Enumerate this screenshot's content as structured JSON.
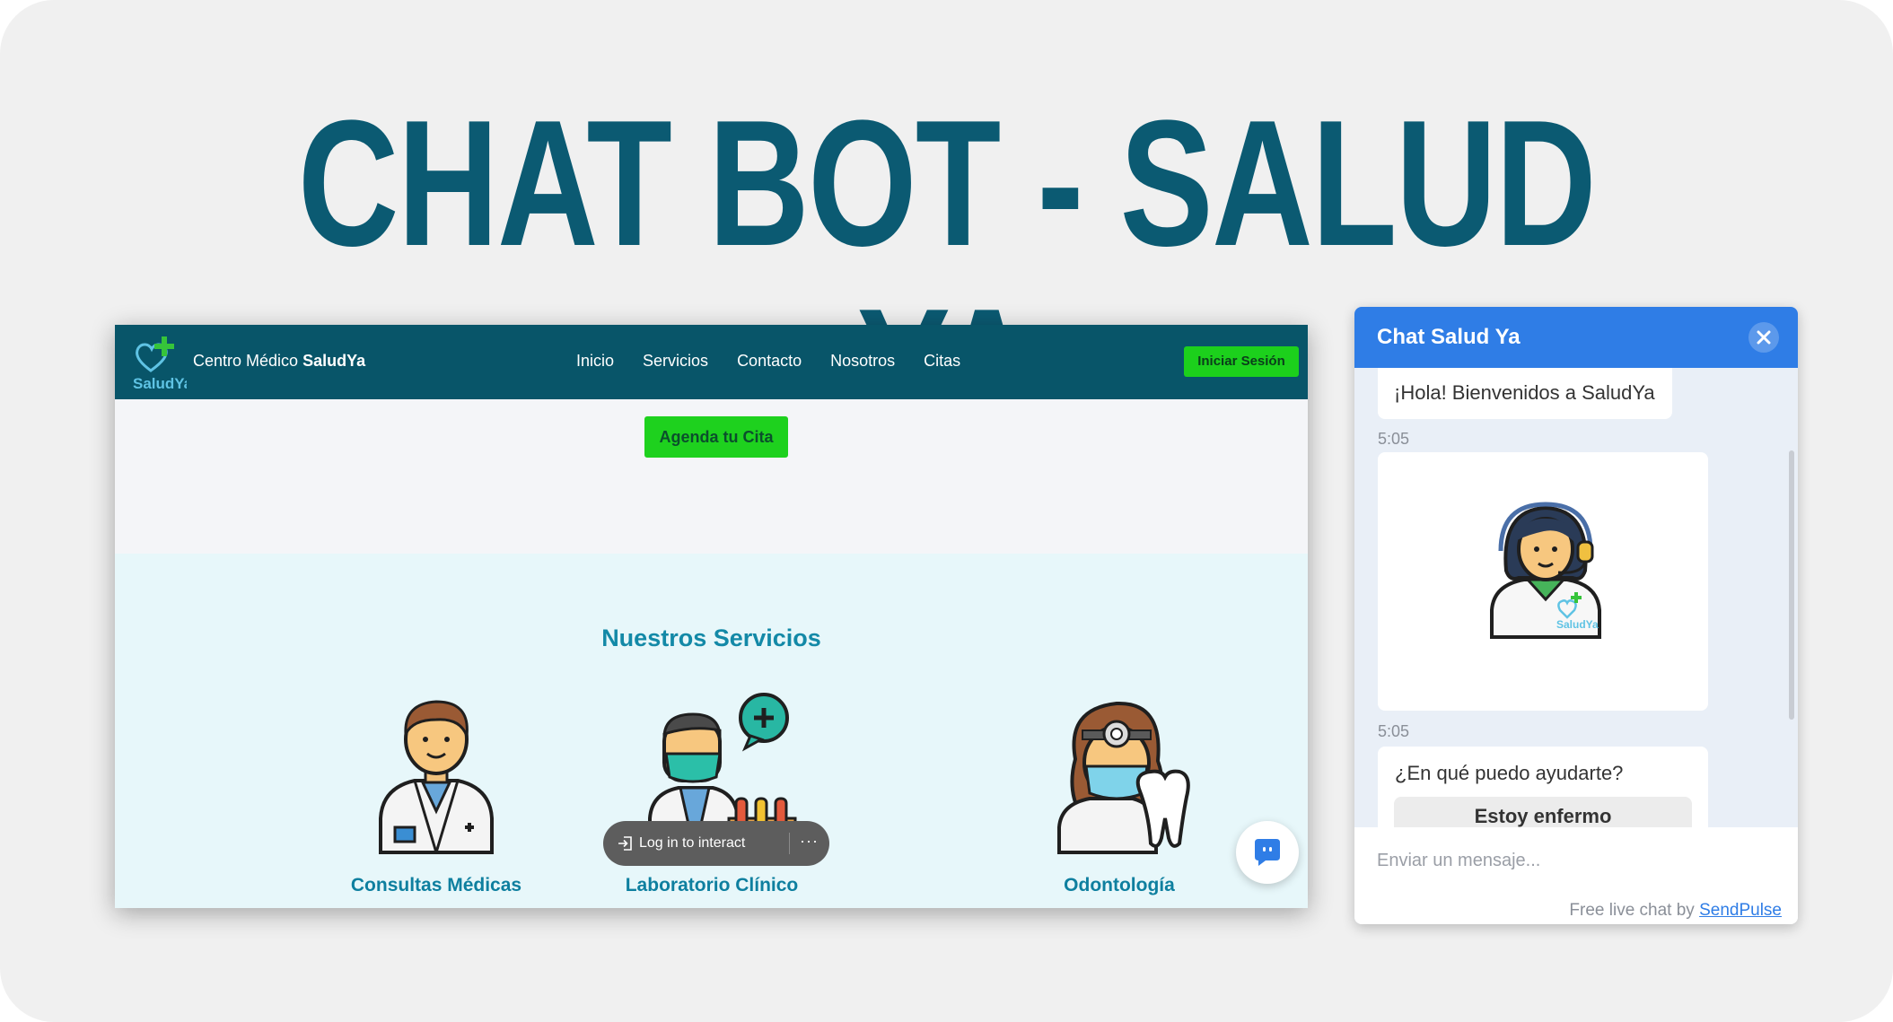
{
  "headline": "CHAT BOT - SALUD YA",
  "website": {
    "logo_text": "SaludYa",
    "brand_prefix": "Centro Médico",
    "brand_name": "SaludYa",
    "nav": [
      "Inicio",
      "Servicios",
      "Contacto",
      "Nosotros",
      "Citas"
    ],
    "login_button": "Iniciar Sesión",
    "cta_button": "Agenda tu Cita",
    "services_title": "Nuestros Servicios",
    "services": [
      {
        "name": "Consultas Médicas",
        "icon": "doctor-icon"
      },
      {
        "name": "Laboratorio Clínico",
        "icon": "lab-technician-icon"
      },
      {
        "name": "Odontología",
        "icon": "dentist-icon"
      }
    ],
    "overlay": {
      "label": "Log in to interact",
      "more": "···"
    }
  },
  "chat": {
    "title": "Chat Salud Ya",
    "greeting": "¡Hola! Bienvenidos a SaludYa",
    "time_1": "5:05",
    "time_2": "5:05",
    "question": "¿En qué puedo ayudarte?",
    "quick_reply": "Estoy enfermo",
    "input_placeholder": "Enviar un mensaje...",
    "powered_prefix": "Free live chat by",
    "powered_link": "SendPulse",
    "agent_badge": "SaludYa"
  },
  "colors": {
    "title": "#0b5a72",
    "navbar": "#085569",
    "green_button": "#1ed11e",
    "service_text": "#0e7f9f",
    "chat_header": "#2f7de6"
  }
}
